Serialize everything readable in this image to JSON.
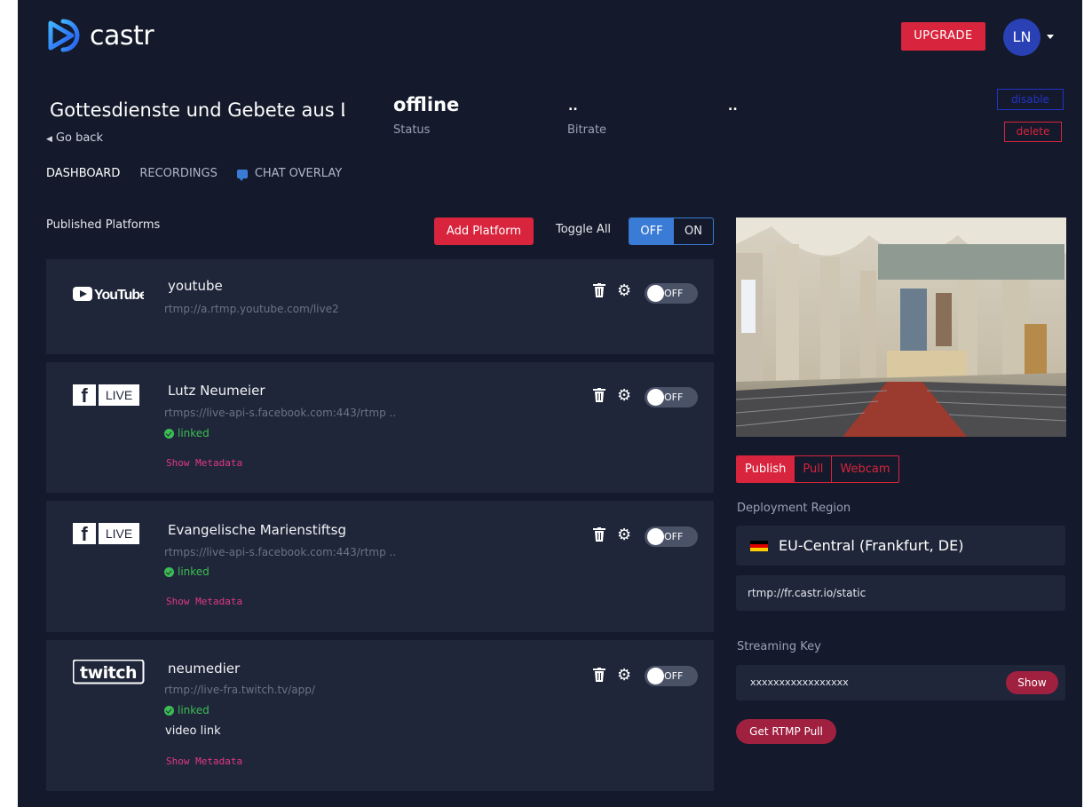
{
  "header": {
    "logo_text": "castr",
    "upgrade_label": "UPGRADE",
    "avatar_initials": "LN"
  },
  "stream": {
    "title": "Gottesdienste und Gebete aus Lich",
    "go_back": "Go back",
    "status_value": "offline",
    "status_label": "Status",
    "bitrate_value": "..",
    "bitrate_label": "Bitrate",
    "extra_value": "..",
    "disable_label": "disable",
    "delete_label": "delete"
  },
  "tabs": [
    {
      "label": "DASHBOARD"
    },
    {
      "label": "RECORDINGS"
    },
    {
      "label": "CHAT OVERLAY"
    }
  ],
  "platforms_section": {
    "label": "Published Platforms",
    "add_platform": "Add Platform",
    "toggle_all_label": "Toggle All",
    "toggle_off": "OFF",
    "toggle_on": "ON"
  },
  "platforms": [
    {
      "logo": "YouTube",
      "name": "youtube",
      "url": "rtmp://a.rtmp.youtube.com/live2",
      "toggle": "OFF"
    },
    {
      "logo_badge": "LIVE",
      "name": "Lutz Neumeier",
      "url": "rtmps://live-api-s.facebook.com:443/rtmp ..",
      "linked": "linked",
      "show_metadata": "Show Metadata",
      "toggle": "OFF"
    },
    {
      "logo_badge": "LIVE",
      "name": "Evangelische Marienstiftsg",
      "url": "rtmps://live-api-s.facebook.com:443/rtmp ..",
      "linked": "linked",
      "show_metadata": "Show Metadata",
      "toggle": "OFF"
    },
    {
      "logo": "twitch",
      "name": "neumedier",
      "url": "rtmp://live-fra.twitch.tv/app/",
      "linked": "linked",
      "video_link": "video link",
      "show_metadata": "Show Metadata",
      "toggle": "OFF"
    }
  ],
  "source": {
    "tabs": [
      "Publish",
      "Pull",
      "Webcam"
    ],
    "active_tab": "Publish",
    "deployment_label": "Deployment Region",
    "region": "EU-Central (Frankfurt, DE)",
    "rtmp_url": "rtmp://fr.castr.io/static",
    "streaming_key_label": "Streaming Key",
    "streaming_key": "xxxxxxxxxxxxxxxxx",
    "show_label": "Show",
    "rtmp_pull_label": "Get RTMP Pull"
  },
  "colors": {
    "background": "#141a2b",
    "card": "#1f2639",
    "accent_red": "#d8243c",
    "accent_blue": "#3a7bd5",
    "linked_green": "#3cbd54"
  },
  "icons": [
    "castr-logo-icon",
    "chat-icon",
    "trash-icon",
    "gear-icon",
    "check-circle-icon",
    "germany-flag-icon"
  ]
}
